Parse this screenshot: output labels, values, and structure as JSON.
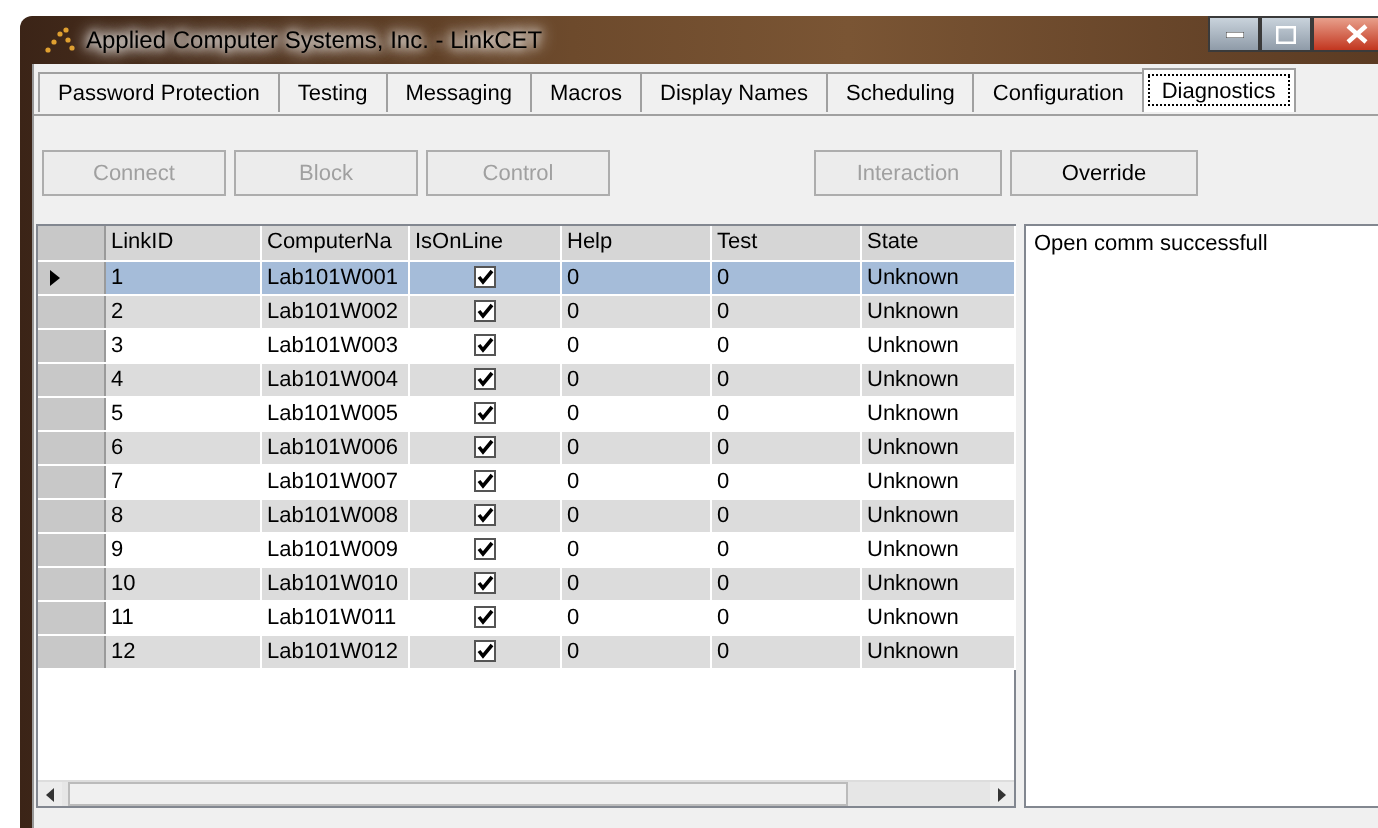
{
  "window": {
    "title": "Applied Computer Systems, Inc. - LinkCET"
  },
  "tabs": [
    {
      "label": "Password Protection",
      "selected": false
    },
    {
      "label": "Testing",
      "selected": false
    },
    {
      "label": "Messaging",
      "selected": false
    },
    {
      "label": "Macros",
      "selected": false
    },
    {
      "label": "Display Names",
      "selected": false
    },
    {
      "label": "Scheduling",
      "selected": false
    },
    {
      "label": "Configuration",
      "selected": false
    },
    {
      "label": "Diagnostics",
      "selected": true
    }
  ],
  "buttons": [
    [
      {
        "label": "Connect",
        "disabled": true
      },
      {
        "label": "Block",
        "disabled": true
      },
      {
        "label": "Control",
        "disabled": true
      }
    ],
    [
      {
        "label": "Interaction",
        "disabled": true
      },
      {
        "label": "Override",
        "disabled": false
      }
    ]
  ],
  "table": {
    "columns": [
      "LinkID",
      "ComputerNa",
      "IsOnLine",
      "Help",
      "Test",
      "State"
    ],
    "rows": [
      {
        "link_id": "1",
        "computer": "Lab101W001",
        "online": true,
        "help": "0",
        "test": "0",
        "state": "Unknown",
        "selected": true
      },
      {
        "link_id": "2",
        "computer": "Lab101W002",
        "online": true,
        "help": "0",
        "test": "0",
        "state": "Unknown",
        "selected": false
      },
      {
        "link_id": "3",
        "computer": "Lab101W003",
        "online": true,
        "help": "0",
        "test": "0",
        "state": "Unknown",
        "selected": false
      },
      {
        "link_id": "4",
        "computer": "Lab101W004",
        "online": true,
        "help": "0",
        "test": "0",
        "state": "Unknown",
        "selected": false
      },
      {
        "link_id": "5",
        "computer": "Lab101W005",
        "online": true,
        "help": "0",
        "test": "0",
        "state": "Unknown",
        "selected": false
      },
      {
        "link_id": "6",
        "computer": "Lab101W006",
        "online": true,
        "help": "0",
        "test": "0",
        "state": "Unknown",
        "selected": false
      },
      {
        "link_id": "7",
        "computer": "Lab101W007",
        "online": true,
        "help": "0",
        "test": "0",
        "state": "Unknown",
        "selected": false
      },
      {
        "link_id": "8",
        "computer": "Lab101W008",
        "online": true,
        "help": "0",
        "test": "0",
        "state": "Unknown",
        "selected": false
      },
      {
        "link_id": "9",
        "computer": "Lab101W009",
        "online": true,
        "help": "0",
        "test": "0",
        "state": "Unknown",
        "selected": false
      },
      {
        "link_id": "10",
        "computer": "Lab101W010",
        "online": true,
        "help": "0",
        "test": "0",
        "state": "Unknown",
        "selected": false
      },
      {
        "link_id": "11",
        "computer": "Lab101W011",
        "online": true,
        "help": "0",
        "test": "0",
        "state": "Unknown",
        "selected": false
      },
      {
        "link_id": "12",
        "computer": "Lab101W012",
        "online": true,
        "help": "0",
        "test": "0",
        "state": "Unknown",
        "selected": false
      }
    ]
  },
  "log": {
    "text": "Open comm successfull"
  }
}
